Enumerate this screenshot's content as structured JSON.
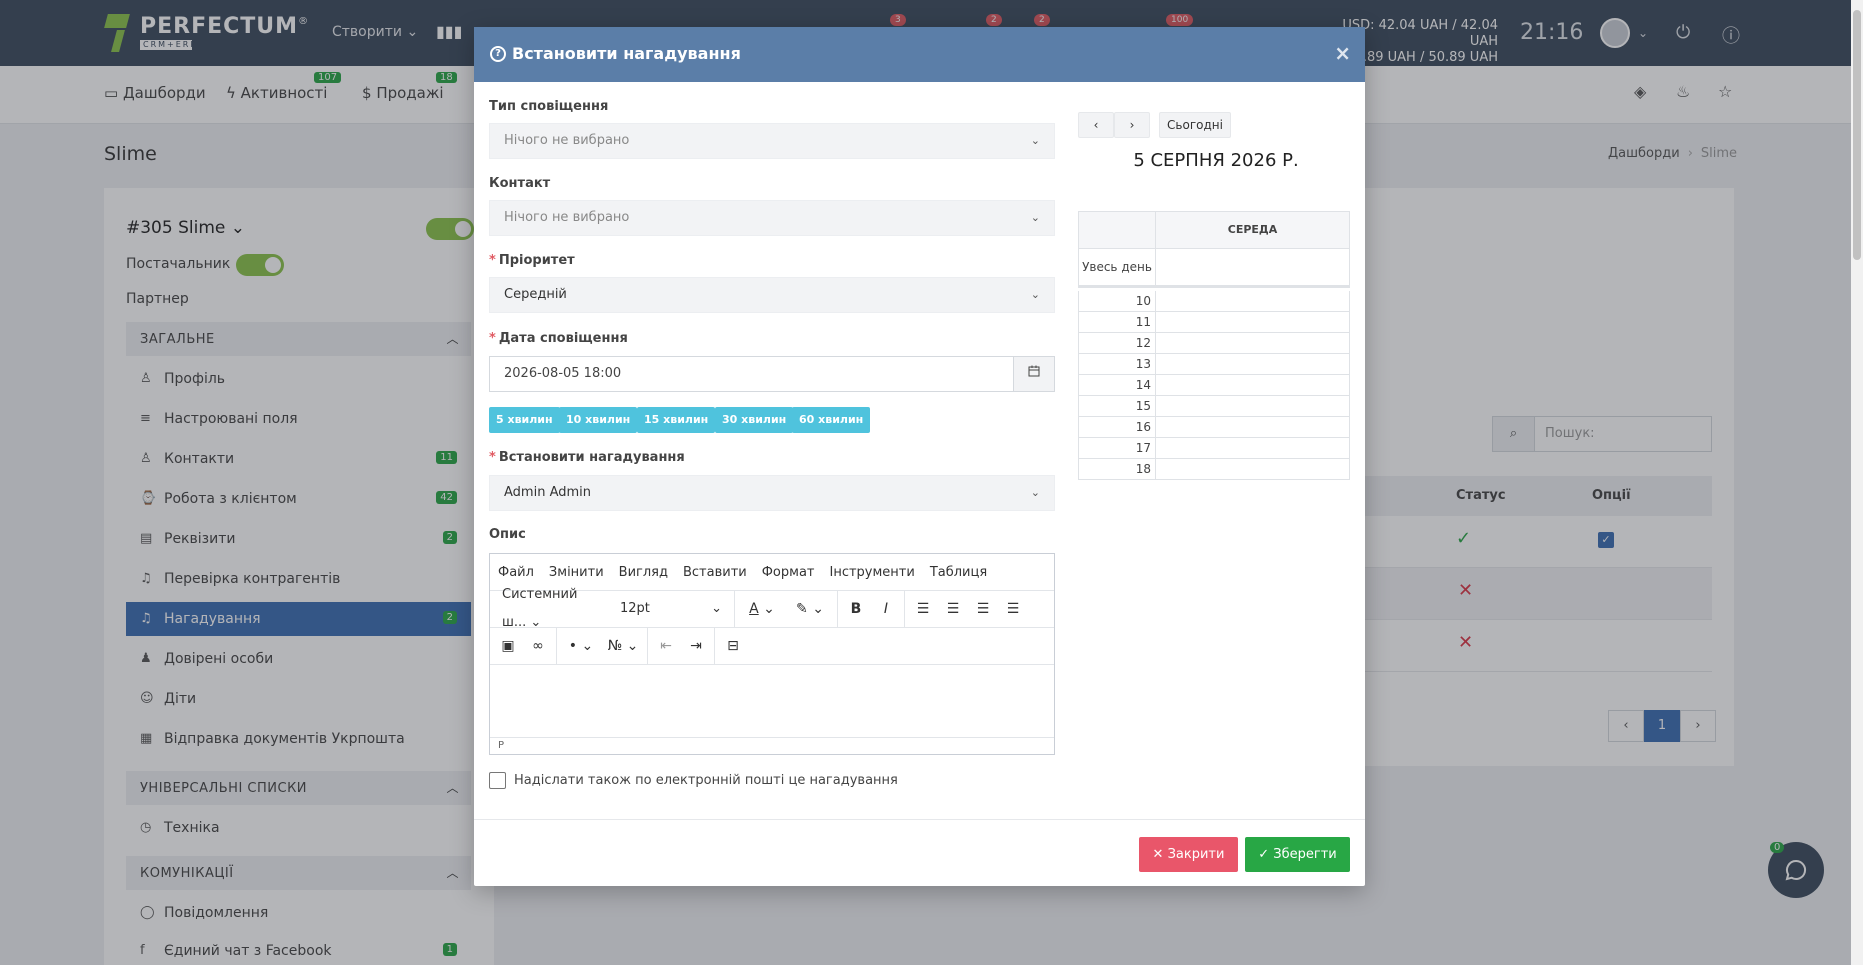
{
  "app": {
    "logo_text": "PERFECTUM",
    "logo_sub": "CRM+ERP",
    "create_label": "Створити",
    "badges": [
      "3",
      "2",
      "2",
      "100"
    ],
    "currency_line1": "USD: 42.04 UAH / 42.04 UAH",
    "currency_line2": "50.89 UAH / 50.89 UAH",
    "time": "21:16"
  },
  "nav": {
    "dashboards": "Дашборди",
    "activities": "Активності",
    "activities_badge": "107",
    "sales": "Продажі",
    "sales_badge": "18"
  },
  "page": {
    "title": "Slime",
    "breadcrumb_home": "Дашборди",
    "breadcrumb_current": "Slime"
  },
  "side": {
    "title": "#305 Slime",
    "supplier_label": "Постачальник",
    "partner_label": "Партнер",
    "section_general": "ЗАГАЛЬНЕ",
    "items": [
      {
        "label": "Профіль",
        "count": ""
      },
      {
        "label": "Настроювані поля",
        "count": ""
      },
      {
        "label": "Контакти",
        "count": "11"
      },
      {
        "label": "Робота з клієнтом",
        "count": "42"
      },
      {
        "label": "Реквізити",
        "count": "2"
      },
      {
        "label": "Перевірка контрагентів",
        "count": ""
      },
      {
        "label": "Нагадування",
        "count": "2"
      },
      {
        "label": "Довірені особи",
        "count": ""
      },
      {
        "label": "Діти",
        "count": ""
      },
      {
        "label": "Відправка документів Укрпошта",
        "count": ""
      }
    ],
    "section_lists": "УНІВЕРСАЛЬНІ СПИСКИ",
    "lists_item": "Техніка",
    "section_comm": "КОМУНІКАЦІЇ",
    "comm_items": [
      {
        "label": "Повідомлення",
        "count": ""
      },
      {
        "label": "Єдиний чат з Facebook",
        "count": "1"
      }
    ]
  },
  "table": {
    "search_placeholder": "Пошук:",
    "col_status": "Статус",
    "col_options": "Опції",
    "page": "1"
  },
  "chat_badge": "0",
  "modal": {
    "title": "Встановити нагадування",
    "notify_type_label": "Тип сповіщення",
    "notify_type_value": "Нічого не вибрано",
    "contact_label": "Контакт",
    "contact_value": "Нічого не вибрано",
    "priority_label": "Пріоритет",
    "priority_value": "Середній",
    "date_label": "Дата сповіщення",
    "date_value": "2026-08-05 18:00",
    "quick": [
      "5 хвилин",
      "10 хвилин",
      "15 хвилин",
      "30 хвилин",
      "60 хвилин"
    ],
    "assignee_label": "Встановити нагадування",
    "assignee_value": "Admin Admin",
    "desc_label": "Опис",
    "editor": {
      "menu": [
        "Файл",
        "Змінити",
        "Вигляд",
        "Вставити",
        "Формат",
        "Інструменти",
        "Таблиця"
      ],
      "font": "Системний ш...",
      "size": "12pt",
      "status": "P"
    },
    "email_label": "Надіслати також по електронній пошті це нагадування",
    "btn_close": "Закрити",
    "btn_save": "Зберегти",
    "calendar": {
      "today": "Сьогодні",
      "title": "5 СЕРПНЯ 2026 Р.",
      "day": "СЕРЕДА",
      "all_day": "Увесь день",
      "hours": [
        "10",
        "11",
        "12",
        "13",
        "14",
        "15",
        "16",
        "17",
        "18"
      ]
    }
  }
}
